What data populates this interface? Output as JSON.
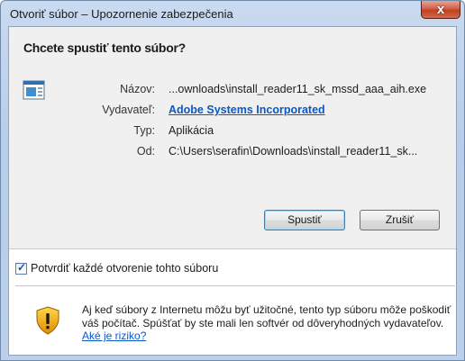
{
  "window": {
    "title": "Otvoriť súbor – Upozornenie zabezpečenia",
    "close_label": "x"
  },
  "dialog": {
    "question": "Chcete spustiť tento súbor?",
    "fields": {
      "name_label": "Názov:",
      "name_value": "...ownloads\\install_reader11_sk_mssd_aaa_aih.exe",
      "publisher_label": "Vydavateľ:",
      "publisher_value": "Adobe Systems Incorporated",
      "type_label": "Typ:",
      "type_value": "Aplikácia",
      "from_label": "Od:",
      "from_value": "C:\\Users\\serafin\\Downloads\\install_reader11_sk..."
    },
    "buttons": {
      "run_label": "Spustiť",
      "cancel_label": "Zrušiť"
    },
    "checkbox": {
      "label": "Potvrdiť každé otvorenie tohto súboru",
      "checked": true
    },
    "warning": {
      "text": "Aj keď súbory z Internetu môžu byť užitočné, tento typ súboru môže poškodiť váš počítač. Spúšťať by ste mali len softvér od dôveryhodných vydavateľov.",
      "link": "Aké je riziko?"
    }
  },
  "icons": {
    "app": "application-icon",
    "warning": "shield-warning-icon",
    "close": "close-icon"
  },
  "colors": {
    "link": "#0b57c6",
    "close_button": "#c1401f",
    "title_bar": "#c9daf0"
  }
}
